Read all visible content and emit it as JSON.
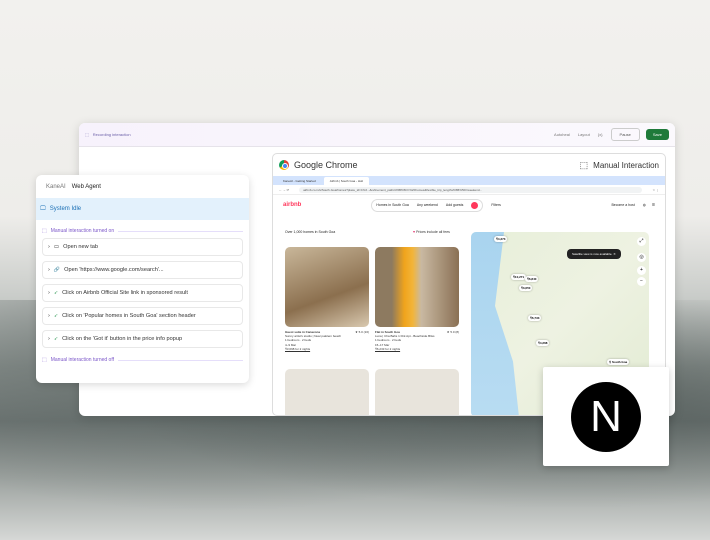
{
  "window": {
    "recording_label": "Recording interaction",
    "autoheal": "Autoheal",
    "layout": "Layout",
    "variables": "{x}",
    "pause": "Pause",
    "save": "Save"
  },
  "chrome": {
    "title": "Google Chrome",
    "mode": "Manual Interaction",
    "tabs": [
      "KaneAI - Getting Started",
      "Airbnb | South Goa - Holi"
    ],
    "url": "airbnb.co.in/s/South-Goa/homes?place_id=ChIJ...&refinement_paths%5B%5D=%2Fhomes&flexible_trip_lengths%5B%5D=weekend...",
    "airbnb": {
      "logo": "airbnb",
      "search": [
        "Homes in South Goa",
        "Any weekend",
        "Add guests"
      ],
      "filters": "Filters",
      "host": "Become a host",
      "count": "Over 1,000 homes in South Goa",
      "prices": "Prices include all fees",
      "listings": [
        {
          "title": "Guest suite in Canacona",
          "rating": "★ 5.0 (16)",
          "desc": "Sunny artist's studio | Near palolem beach",
          "beds": "1 bedroom · 2 beds",
          "dates": "4–9 Mar",
          "price": "₹3,698 for 2 nights"
        },
        {
          "title": "Flat in South Goa",
          "rating": "★ 5.0 (8)",
          "desc": "Luna | Cha Bahs 1 bhk Apt - Beachside Bliss",
          "beds": "1 bedroom · 2 beds",
          "dates": "15–17 Mar",
          "price": "₹6,233 for 2 nights"
        }
      ],
      "map": {
        "toast": "Satellite view is now available.",
        "pins": [
          "₹4,373",
          "₹10,271",
          "₹6,840",
          "₹3,650",
          "₹6,733",
          "₹4,268"
        ],
        "place": "South Goa"
      }
    }
  },
  "panel": {
    "tabs": [
      "KaneAI",
      "Web Agent"
    ],
    "status": "System Idle",
    "start": "Manual interaction turned on",
    "end": "Manual interaction turned off",
    "steps": [
      "Open new tab",
      "Open 'https://www.google.com/search'...",
      "Click on Airbnb Official Site link in sponsored result",
      "Click on 'Popular homes in South Goa' section header",
      "Click on the 'Got it' button in the price info popup"
    ]
  },
  "badge": {
    "logo": "N"
  }
}
